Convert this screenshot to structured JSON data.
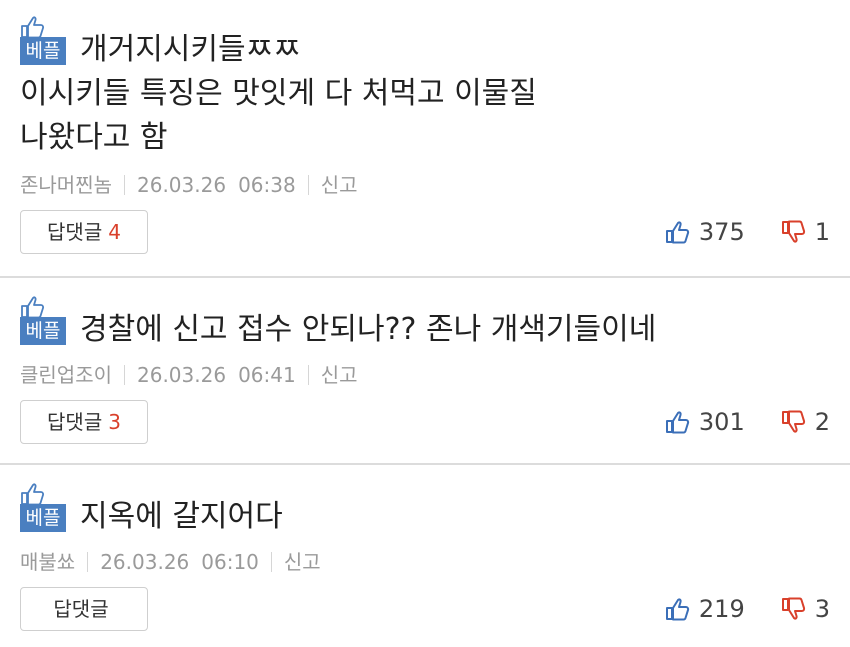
{
  "badge_label": "베플",
  "reply_label": "답댓글",
  "report_label": "신고",
  "colors": {
    "badge": "#4a7fc0",
    "like": "#3b6fb8",
    "dislike": "#d9402b",
    "reply_count": "#d9402b"
  },
  "comments": [
    {
      "lines": [
        "개거지시키들ㅉㅉ",
        "이시키들 특징은 맛잇게 다 처먹고 이물질",
        "나왔다고 함"
      ],
      "author": "존나머찐놈",
      "date": "26.03.26",
      "time": "06:38",
      "reply_count": "4",
      "likes": "375",
      "dislikes": "1"
    },
    {
      "lines": [
        "경찰에 신고 접수 안되나?? 존나 개색기들이네"
      ],
      "author": "클린업조이",
      "date": "26.03.26",
      "time": "06:41",
      "reply_count": "3",
      "likes": "301",
      "dislikes": "2"
    },
    {
      "lines": [
        "지옥에 갈지어다"
      ],
      "author": "매불쑈",
      "date": "26.03.26",
      "time": "06:10",
      "reply_count": "",
      "likes": "219",
      "dislikes": "3"
    }
  ]
}
